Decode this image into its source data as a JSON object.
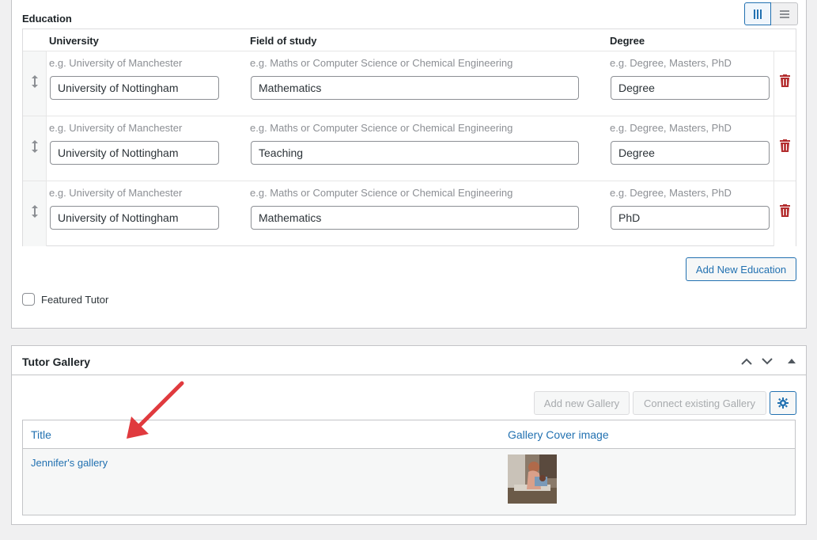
{
  "education": {
    "section_label": "Education",
    "columns": {
      "university": "University",
      "field": "Field of study",
      "degree": "Degree"
    },
    "rows": [
      {
        "university_placeholder": "e.g. University of Manchester",
        "university": "University of Nottingham",
        "field_placeholder": "e.g. Maths or Computer Science or Chemical Engineering",
        "field": "Mathematics",
        "degree_placeholder": "e.g. Degree, Masters, PhD",
        "degree": "Degree"
      },
      {
        "university_placeholder": "e.g. University of Manchester",
        "university": "University of Nottingham",
        "field_placeholder": "e.g. Maths or Computer Science or Chemical Engineering",
        "field": "Teaching",
        "degree_placeholder": "e.g. Degree, Masters, PhD",
        "degree": "Degree"
      },
      {
        "university_placeholder": "e.g. University of Manchester",
        "university": "University of Nottingham",
        "field_placeholder": "e.g. Maths or Computer Science or Chemical Engineering",
        "field": "Mathematics",
        "degree_placeholder": "e.g. Degree, Masters, PhD",
        "degree": "PhD"
      }
    ],
    "add_button": "Add New Education",
    "featured_label": "Featured Tutor",
    "featured_checked": false,
    "view_toggle": {
      "active_icon": "columns-icon",
      "inactive_icon": "list-icon"
    }
  },
  "gallery": {
    "title": "Tutor Gallery",
    "add_new_label": "Add new Gallery",
    "connect_label": "Connect existing Gallery",
    "settings_icon": "gear-icon",
    "columns": {
      "title": "Title",
      "cover": "Gallery Cover image"
    },
    "items": [
      {
        "title": "Jennifer's gallery"
      }
    ]
  },
  "colors": {
    "accent": "#2271b1",
    "danger": "#b32d2e",
    "annotation_arrow": "#e03a3e"
  }
}
